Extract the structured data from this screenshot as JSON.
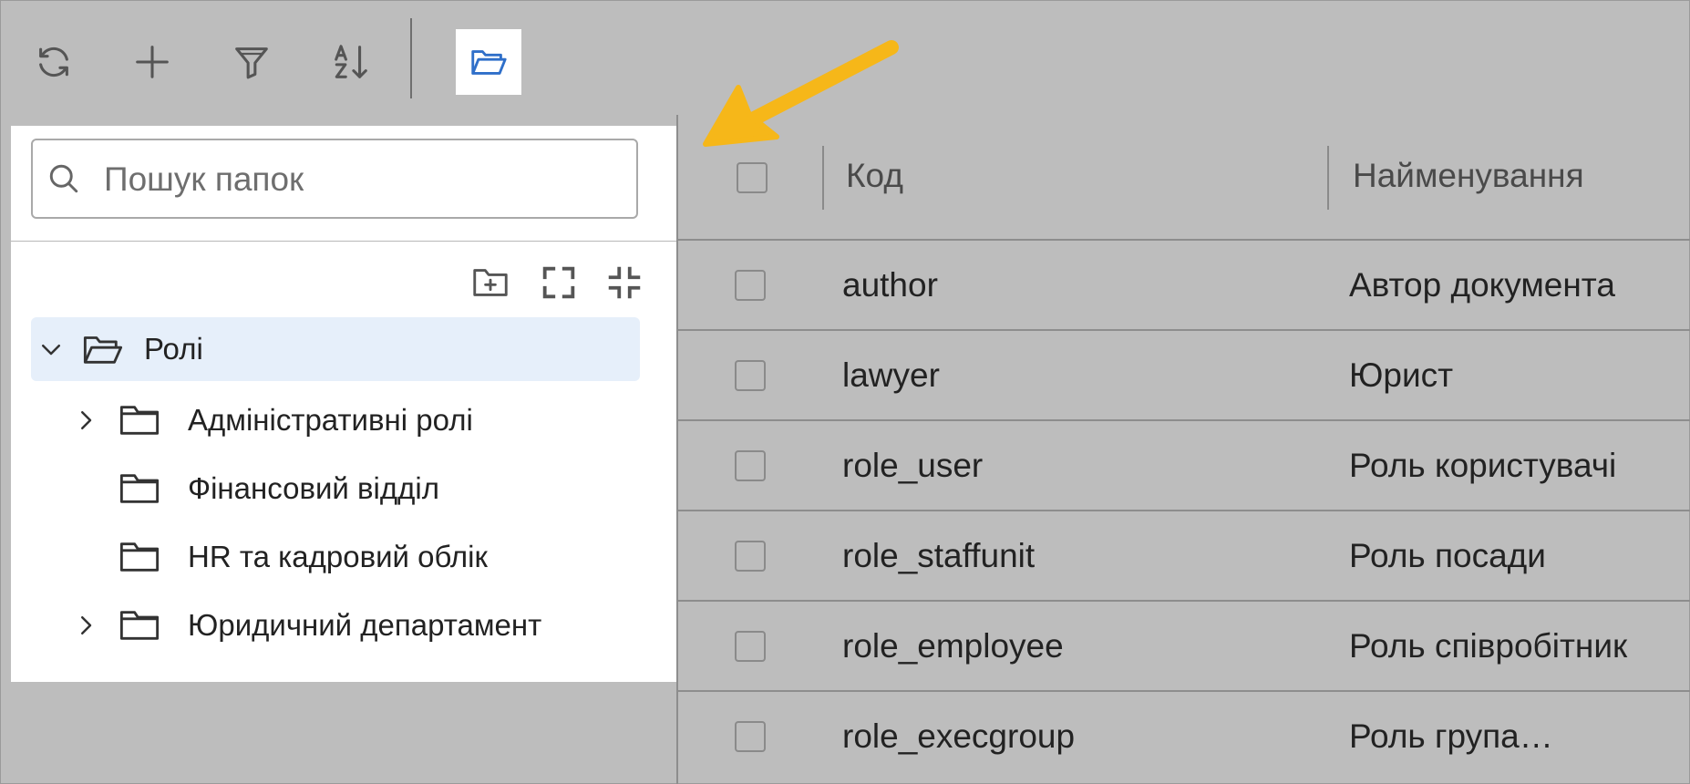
{
  "toolbar": {
    "buttons": [
      {
        "name": "refresh",
        "icon": "refresh-icon"
      },
      {
        "name": "add",
        "icon": "plus-icon"
      },
      {
        "name": "filter",
        "icon": "filter-icon"
      },
      {
        "name": "sort",
        "icon": "sort-az-icon"
      },
      {
        "name": "folders",
        "icon": "folder-open-icon",
        "active": true
      }
    ]
  },
  "folder_panel": {
    "search": {
      "placeholder": "Пошук папок",
      "value": ""
    },
    "actions": [
      "add-folder-icon",
      "expand-icon",
      "collapse-icon"
    ],
    "tree": {
      "root": {
        "label": "Ролі",
        "expanded": true,
        "selected": true
      },
      "children": [
        {
          "label": "Адміністративні ролі",
          "has_children": true
        },
        {
          "label": "Фінансовий відділ",
          "has_children": false
        },
        {
          "label": "HR та кадровий облік",
          "has_children": false
        },
        {
          "label": "Юридичний департамент",
          "has_children": true
        }
      ]
    }
  },
  "table": {
    "columns": {
      "code": "Код",
      "name": "Найменування"
    },
    "rows": [
      {
        "code": "author",
        "name": "Автор документа"
      },
      {
        "code": "lawyer",
        "name": "Юрист"
      },
      {
        "code": "role_user",
        "name": "Роль користувачі"
      },
      {
        "code": "role_staffunit",
        "name": "Роль посади"
      },
      {
        "code": "role_employee",
        "name": "Роль співробітник"
      },
      {
        "code": "role_execgroup",
        "name": "Роль група…"
      }
    ]
  },
  "colors": {
    "background": "#bdbdbd",
    "panel": "#ffffff",
    "selected_row": "#e6effa",
    "accent_blue": "#2f6fc9",
    "arrow": "#f6b719"
  }
}
